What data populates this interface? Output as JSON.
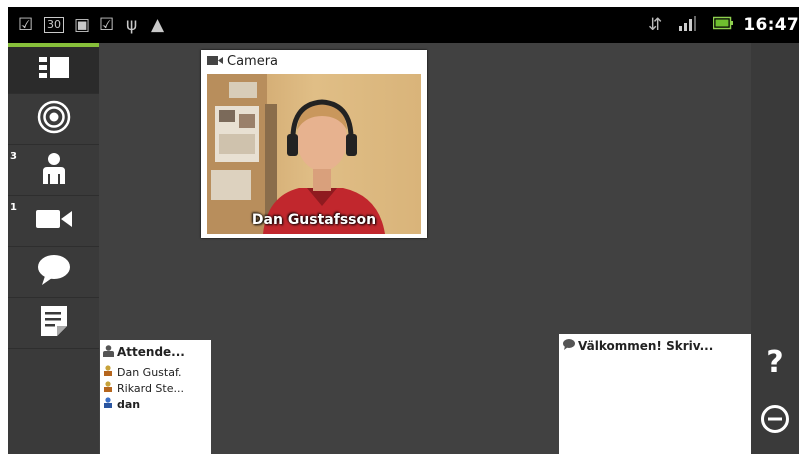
{
  "statusbar": {
    "left_icons": [
      "checkbox-notification-icon",
      "calendar-icon",
      "briefcase-icon",
      "checkbox-notification-icon",
      "usb-icon",
      "android-debug-icon"
    ],
    "calendar_day": "30",
    "right_icons": [
      "network-icon",
      "signal-icon",
      "battery-icon"
    ],
    "time": "16:47"
  },
  "sidebar": {
    "items": [
      {
        "name": "layout",
        "icon": "layout-icon",
        "badge": ""
      },
      {
        "name": "broadcast",
        "icon": "target-icon",
        "badge": ""
      },
      {
        "name": "attendees",
        "icon": "person-icon",
        "badge": "3"
      },
      {
        "name": "cameras",
        "icon": "video-camera-icon",
        "badge": "1"
      },
      {
        "name": "chat",
        "icon": "speech-bubble-icon",
        "badge": ""
      },
      {
        "name": "notes",
        "icon": "notes-icon",
        "badge": ""
      }
    ]
  },
  "right_bar": {
    "help_label": "?",
    "zoom_out_icon": "minus-circle-icon"
  },
  "camera_window": {
    "title": "Camera",
    "person_name": "Dan Gustafsson"
  },
  "attendees_window": {
    "title": "Attende...",
    "items": [
      {
        "name": "Dan Gustaf.",
        "icon": "person-small-icon",
        "bold": false
      },
      {
        "name": "Rikard Ste...",
        "icon": "person-small-icon",
        "bold": false
      },
      {
        "name": "dan",
        "icon": "person-small-icon",
        "bold": true
      }
    ]
  },
  "chat_window": {
    "title": "Välkommen! Skriv..."
  },
  "colors": {
    "accent": "#87bf3a",
    "background": "#414141",
    "sidebar": "#3a3a3a"
  }
}
